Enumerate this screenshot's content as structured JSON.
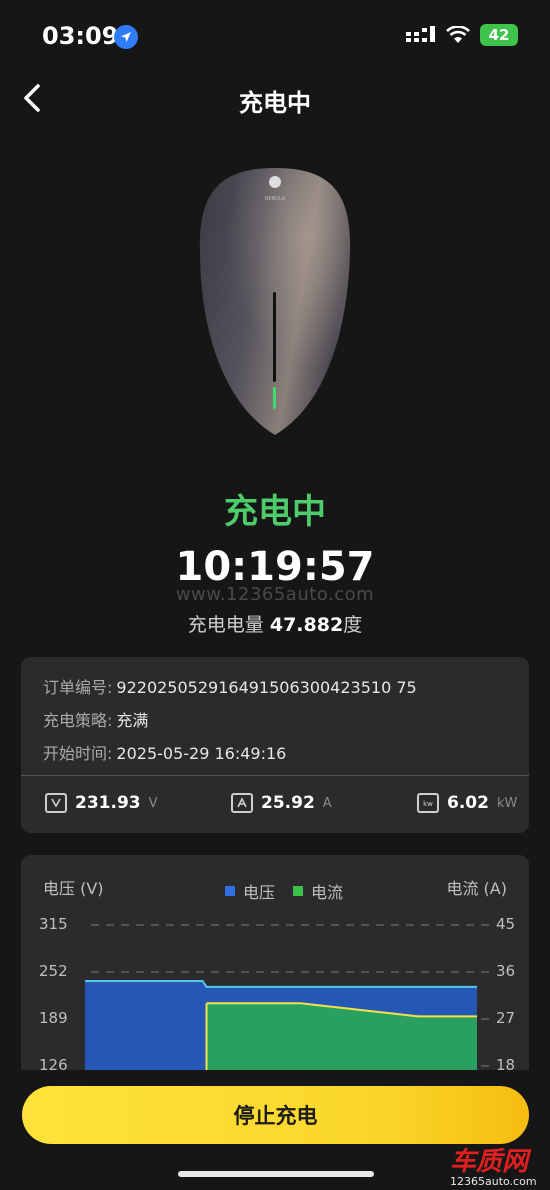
{
  "status_bar": {
    "time": "03:09",
    "battery": "42"
  },
  "nav": {
    "title": "充电中"
  },
  "charger": {
    "brand": "NEBULA"
  },
  "charging": {
    "status": "充电中",
    "elapsed": "10:19:57",
    "watermark": "www.12365auto.com",
    "energy_label": "充电电量",
    "energy_value": "47.882",
    "energy_unit": "度"
  },
  "order": {
    "number_label": "订单编号:",
    "number_value": "922025052916491506300423510 75",
    "strategy_label": "充电策略:",
    "strategy_value": "充满",
    "start_label": "开始时间:",
    "start_value": "2025-05-29 16:49:16"
  },
  "metrics": [
    {
      "value": "231.93",
      "unit": "V",
      "icon": "voltage-icon"
    },
    {
      "value": "25.92",
      "unit": "A",
      "icon": "current-icon"
    },
    {
      "value": "6.02",
      "unit": "kW",
      "icon": "power-icon"
    }
  ],
  "chart_data": {
    "type": "area",
    "left_axis_title": "电压 (V)",
    "right_axis_title": "电流 (A)",
    "legend": [
      {
        "name": "电压",
        "color": "#2f6fe0"
      },
      {
        "name": "电流",
        "color": "#3cc04a"
      }
    ],
    "left_ticks": [
      315,
      252,
      189,
      126
    ],
    "right_ticks": [
      45,
      36,
      27,
      18
    ],
    "left_range": [
      126,
      315
    ],
    "right_range": [
      18,
      45
    ],
    "series": [
      {
        "name": "电压",
        "axis": "left",
        "x": [
          0,
          0.3,
          0.31,
          1.0
        ],
        "values": [
          240,
          240,
          232,
          232
        ]
      },
      {
        "name": "电流",
        "axis": "right",
        "x": [
          0,
          0.3,
          0.31,
          0.55,
          0.85,
          1.0
        ],
        "values": [
          0,
          0,
          30,
          30,
          27.5,
          27.5
        ]
      }
    ],
    "grid": true
  },
  "actions": {
    "stop_label": "停止充电"
  },
  "site_logo": {
    "text": "车质网",
    "url": "12365auto.com"
  }
}
